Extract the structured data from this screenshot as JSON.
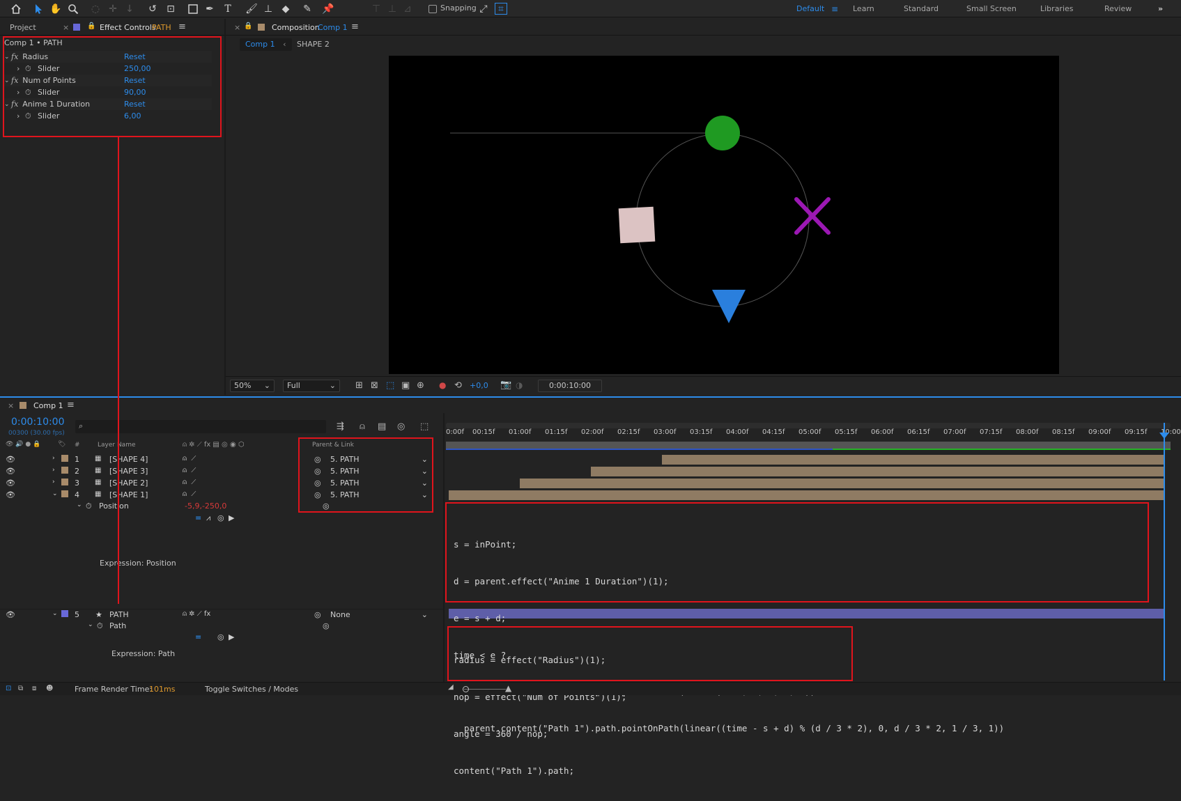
{
  "toolbar": {
    "snapping_label": "Snapping",
    "workspaces": [
      "Default",
      "Learn",
      "Standard",
      "Small Screen",
      "Libraries",
      "Review"
    ]
  },
  "left_panel": {
    "tab_project": "Project",
    "tab_effect_controls": "Effect Controls",
    "tab_effect_layer": "PATH",
    "breadcrumb": "Comp 1 • PATH",
    "effects": [
      {
        "name": "Radius",
        "reset": "Reset",
        "param": "Slider",
        "value": "250,00"
      },
      {
        "name": "Num of Points",
        "reset": "Reset",
        "param": "Slider",
        "value": "90,00"
      },
      {
        "name": "Anime 1 Duration",
        "reset": "Reset",
        "param": "Slider",
        "value": "6,00"
      }
    ]
  },
  "comp_panel": {
    "tab_label": "Composition",
    "tab_comp": "Comp 1",
    "breadcrumb_comp": "Comp 1",
    "breadcrumb_layer": "SHAPE 2",
    "zoom": "50%",
    "resolution": "Full",
    "exposure": "+0,0",
    "timecode": "0:00:10:00",
    "colors": {
      "circle": "#1f9a22",
      "square": "#dcc3c3",
      "cross": "#9b18b3",
      "triangle": "#2a7fdd"
    }
  },
  "timeline": {
    "tab_label": "Comp 1",
    "current_time": "0:00:10:00",
    "frame_info": "00300 (30.00 fps)",
    "col_hash": "#",
    "col_layer_name": "Layer Name",
    "col_parent": "Parent & Link",
    "ruler": [
      "0:00f",
      "00:15f",
      "01:00f",
      "01:15f",
      "02:00f",
      "02:15f",
      "03:00f",
      "03:15f",
      "04:00f",
      "04:15f",
      "05:00f",
      "05:15f",
      "06:00f",
      "06:15f",
      "07:00f",
      "07:15f",
      "08:00f",
      "08:15f",
      "09:00f",
      "09:15f",
      "10:00"
    ],
    "layers": [
      {
        "num": "1",
        "name": "[SHAPE 4]",
        "parent": "5. PATH"
      },
      {
        "num": "2",
        "name": "[SHAPE 3]",
        "parent": "5. PATH"
      },
      {
        "num": "3",
        "name": "[SHAPE 2]",
        "parent": "5. PATH"
      },
      {
        "num": "4",
        "name": "[SHAPE 1]",
        "parent": "5. PATH"
      }
    ],
    "position_label": "Position",
    "position_value": "-5,9,-250,0",
    "expr_position_label": "Expression: Position",
    "layer5": {
      "num": "5",
      "name": "PATH",
      "parent": "None"
    },
    "path_label": "Path",
    "expr_path_label": "Expression: Path",
    "frame_render_label": "Frame Render Time:",
    "frame_render_value": "101ms",
    "toggle_label": "Toggle Switches / Modes"
  },
  "code_position": [
    "s = inPoint;",
    "d = parent.effect(\"Anime 1 Duration\")(1);",
    "e = s + d;",
    "time < e ?",
    "  parent.content(\"Path 1\").path.pointOnPath(linear(time, s, e, 0, 1)) :",
    "  parent.content(\"Path 1\").path.pointOnPath(linear((time - s + d) % (d / 3 * 2), 0, d / 3 * 2, 1 / 3, 1))"
  ],
  "code_path": [
    "radius = effect(\"Radius\")(1);",
    "nop = effect(\"Num of Points\")(1);",
    "angle = 360 / nop;",
    "content(\"Path 1\").path;"
  ]
}
